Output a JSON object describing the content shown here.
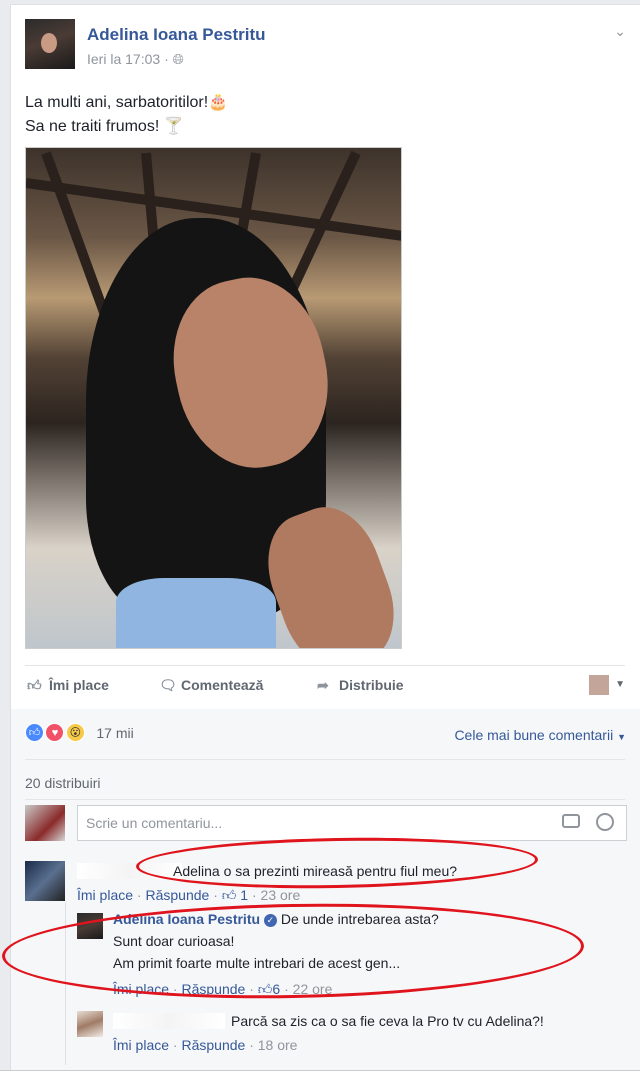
{
  "post": {
    "author": "Adelina Ioana Pestritu",
    "time": "Ieri la 17:03",
    "privacy_icon": "globe-icon",
    "text_line1": "La multi ani, sarbatoritilor!",
    "text_line1_emoji": "🎂",
    "text_line2": "Sa ne traiti frumos!",
    "text_line2_emoji": "🍸"
  },
  "actions": {
    "like": "Îmi place",
    "comment": "Comentează",
    "share": "Distribuie"
  },
  "stats": {
    "reactions": [
      "like-icon",
      "love-icon",
      "wow-icon"
    ],
    "reaction_count": "17 mii",
    "sort_label": "Cele mai bune comentarii",
    "shares": "20 distribuiri"
  },
  "composer": {
    "placeholder": "Scrie un comentariu..."
  },
  "comments": [
    {
      "text": "Adelina o sa prezinti mireasă pentru fiul meu?",
      "like": "Îmi place",
      "reply": "Răspunde",
      "likes": "1",
      "time": "23 ore",
      "replies": [
        {
          "author": "Adelina Ioana Pestritu",
          "line1": "De unde intrebarea asta?",
          "line2": "Sunt doar curioasa!",
          "line3": "Am primit foarte multe intrebari de acest gen...",
          "like": "Îmi place",
          "reply": "Răspunde",
          "likes": "6",
          "time": "22 ore"
        },
        {
          "text": "Parcă sa zis ca o sa fie ceva la Pro tv cu Adelina?!",
          "like": "Îmi place",
          "reply": "Răspunde",
          "time": "18 ore"
        }
      ]
    }
  ],
  "colors": {
    "link": "#365899",
    "muted": "#90949c",
    "annotation": "#e0141c"
  }
}
